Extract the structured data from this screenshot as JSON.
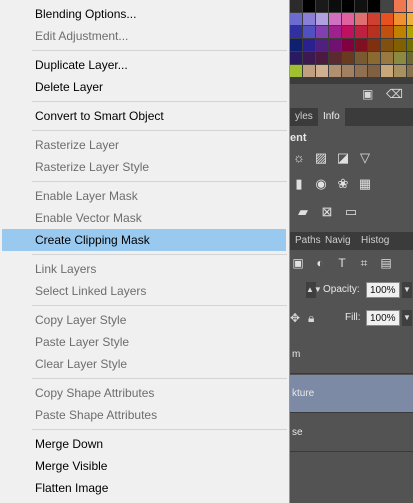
{
  "menu": {
    "items": [
      {
        "label": "Blending Options...",
        "enabled": true
      },
      {
        "label": "Edit Adjustment...",
        "enabled": false
      },
      {
        "label": "Duplicate Layer...",
        "enabled": true
      },
      {
        "label": "Delete Layer",
        "enabled": true
      },
      {
        "label": "Convert to Smart Object",
        "enabled": true
      },
      {
        "label": "Rasterize Layer",
        "enabled": false
      },
      {
        "label": "Rasterize Layer Style",
        "enabled": false
      },
      {
        "label": "Enable Layer Mask",
        "enabled": false
      },
      {
        "label": "Enable Vector Mask",
        "enabled": false
      },
      {
        "label": "Create Clipping Mask",
        "enabled": true,
        "highlighted": true
      },
      {
        "label": "Link Layers",
        "enabled": false
      },
      {
        "label": "Select Linked Layers",
        "enabled": false
      },
      {
        "label": "Copy Layer Style",
        "enabled": false
      },
      {
        "label": "Paste Layer Style",
        "enabled": false
      },
      {
        "label": "Clear Layer Style",
        "enabled": false
      },
      {
        "label": "Copy Shape Attributes",
        "enabled": false
      },
      {
        "label": "Paste Shape Attributes",
        "enabled": false
      },
      {
        "label": "Merge Down",
        "enabled": true
      },
      {
        "label": "Merge Visible",
        "enabled": true
      },
      {
        "label": "Flatten Image",
        "enabled": true
      }
    ]
  },
  "swatches": {
    "colors": [
      "#2b2b2b",
      "#000000",
      "#1a1a1a",
      "#0d0d0d",
      "#000000",
      "#111111",
      "#000000",
      "#444444",
      "#f07850",
      "#f8a080",
      "#6b6bd0",
      "#8a7fd8",
      "#b0a0e0",
      "#d070c0",
      "#e060a0",
      "#e07070",
      "#d04030",
      "#e85020",
      "#f09030",
      "#f0b040",
      "#3030a0",
      "#5050c0",
      "#8040b0",
      "#a02090",
      "#c01060",
      "#c02040",
      "#b83020",
      "#c05010",
      "#c08000",
      "#b0a000",
      "#102070",
      "#2a2090",
      "#502080",
      "#701070",
      "#800040",
      "#801020",
      "#803010",
      "#805010",
      "#806000",
      "#707000",
      "#2a1a60",
      "#3a1a50",
      "#4a1a40",
      "#5a2a30",
      "#6a3a20",
      "#7a5a30",
      "#8a6a30",
      "#9a7a40",
      "#8a8a40",
      "#6a6a30",
      "#a0c030",
      "#c0a080",
      "#d0b090",
      "#b09070",
      "#a08060",
      "#907050",
      "#806040",
      "#c8a878",
      "#a89060",
      "#887048"
    ]
  },
  "panels": {
    "styles_tabs": [
      "yles",
      "Info"
    ],
    "adjustments_title": "ent",
    "layers_tabs": [
      "Paths",
      "Navig",
      "Histog"
    ],
    "opacity_label": "Opacity:",
    "opacity_value": "100%",
    "fill_label": "Fill:",
    "fill_value": "100%",
    "layers": [
      {
        "name": "m",
        "selected": false
      },
      {
        "name": "kture",
        "selected": true
      },
      {
        "name": "se",
        "selected": false
      }
    ]
  },
  "icons": {
    "new-swatch": "▭",
    "trash": "🗑",
    "brightness": "☀",
    "levels": "▲",
    "curves": "∿",
    "exposure": "◐",
    "triangle-down": "▽"
  }
}
